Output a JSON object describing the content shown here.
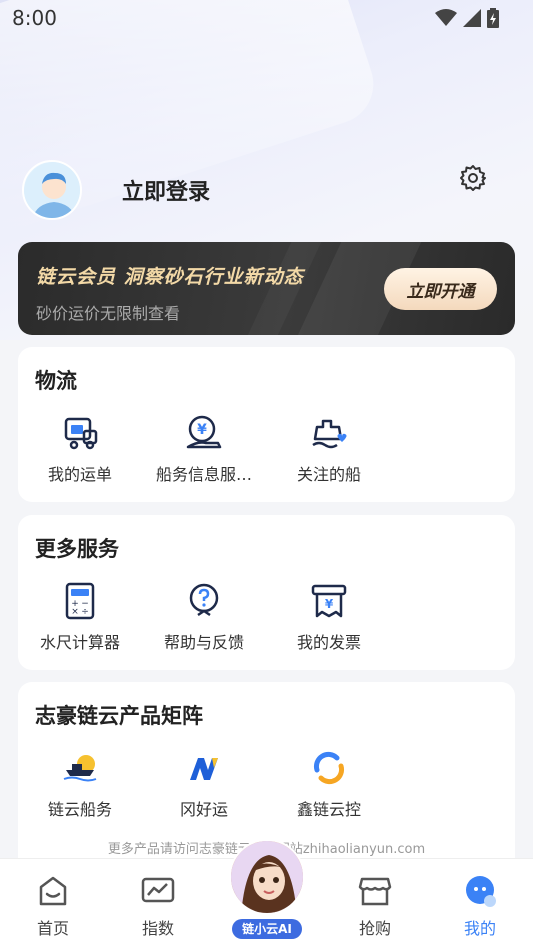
{
  "status_bar": {
    "time": "8:00"
  },
  "profile": {
    "login_text": "立即登录"
  },
  "vip": {
    "title": "链云会员  洞察砂石行业新动态",
    "subtitle": "砂价运价无限制查看",
    "button": "立即开通"
  },
  "logistics": {
    "title": "物流",
    "items": [
      {
        "label": "我的运单",
        "icon": "waybill-icon"
      },
      {
        "label": "船务信息服…",
        "icon": "shipping-service-icon"
      },
      {
        "label": "关注的船",
        "icon": "followed-ship-icon"
      }
    ]
  },
  "services": {
    "title": "更多服务",
    "items": [
      {
        "label": "水尺计算器",
        "icon": "calculator-icon"
      },
      {
        "label": "帮助与反馈",
        "icon": "help-icon"
      },
      {
        "label": "我的发票",
        "icon": "invoice-icon"
      }
    ]
  },
  "products": {
    "title": "志豪链云产品矩阵",
    "items": [
      {
        "label": "链云船务",
        "icon": "ship-logo-icon"
      },
      {
        "label": "冈好运",
        "icon": "n-logo-icon"
      },
      {
        "label": "鑫链云控",
        "icon": "ring-logo-icon"
      }
    ]
  },
  "footer_note": "更多产品请访问志豪链云官方网站zhihaolianyun.com",
  "tabbar": {
    "tabs": [
      {
        "label": "首页",
        "icon": "home-icon"
      },
      {
        "label": "指数",
        "icon": "chart-icon"
      },
      {
        "label": "抢购",
        "icon": "store-icon"
      },
      {
        "label": "我的",
        "icon": "profile-icon"
      }
    ],
    "ai_label": "链小云AI",
    "active": "我的"
  },
  "colors": {
    "accent": "#3b82f6",
    "vip_gold": "#f3d9a7",
    "icon_blue": "#1e3a8a"
  }
}
